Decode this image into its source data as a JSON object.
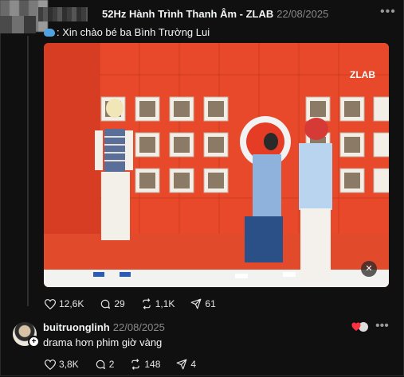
{
  "post": {
    "author": "52Hz Hành Trình Thanh Âm - ZLAB",
    "date": "22/08/2025",
    "caption": ": Xin chào bé ba Bình Trường Lui",
    "video_logo": "ZLAB",
    "stats": {
      "likes": "12,6K",
      "comments": "29",
      "reposts": "1,1K",
      "shares": "61"
    }
  },
  "reply": {
    "author": "buitruonglinh",
    "date": "22/08/2025",
    "text": "drama hơn phim giờ vàng",
    "stats": {
      "likes": "3,8K",
      "comments": "2",
      "reposts": "148",
      "shares": "4"
    }
  },
  "icons": [
    "heart-icon",
    "comment-icon",
    "repost-icon",
    "share-icon",
    "mute-icon",
    "more-icon",
    "whale-icon",
    "follow-plus-icon"
  ],
  "colors": {
    "background": "#101010",
    "wall": "#e84a2a",
    "muted_text": "#8a8a8a",
    "like_red": "#ff3040"
  }
}
